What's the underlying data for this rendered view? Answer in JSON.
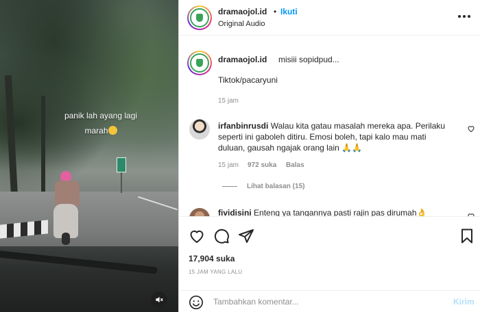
{
  "header": {
    "username": "dramaojol.id",
    "separator": "•",
    "follow_label": "Ikuti",
    "audio": "Original Audio",
    "more_icon": "more-horizontal-icon"
  },
  "video": {
    "caption_line1": "panik lah ayang lagi",
    "caption_line2": "marah",
    "mute_icon": "speaker-muted-icon"
  },
  "post_caption": {
    "username": "dramaojol.id",
    "text": "misiii sopidpud...",
    "text2": "Tiktok/pacaryuni",
    "time": "15 jam"
  },
  "comments": [
    {
      "username": "irfanbinrusdi",
      "text": "Walau kita gatau masalah mereka apa. Perilaku seperti ini gaboleh ditiru. Emosi boleh, tapi kalo mau mati duluan, gausah ngajak orang lain 🙏🙏",
      "time": "15 jam",
      "likes": "972 suka",
      "reply_label": "Balas",
      "view_replies": "Lihat balasan (15)"
    },
    {
      "username": "fividisini",
      "text": "Enteng ya tangannya pasti rajin pas dirumah👌"
    }
  ],
  "actions": {
    "likes": "17,904 suka",
    "date": "15 JAM YANG LALU"
  },
  "add_comment": {
    "placeholder": "Tambahkan komentar...",
    "post_label": "Kirim"
  },
  "colors": {
    "accent": "#0095f6",
    "post_disabled": "#b2dffc",
    "muted_text": "#8e8e8e"
  }
}
